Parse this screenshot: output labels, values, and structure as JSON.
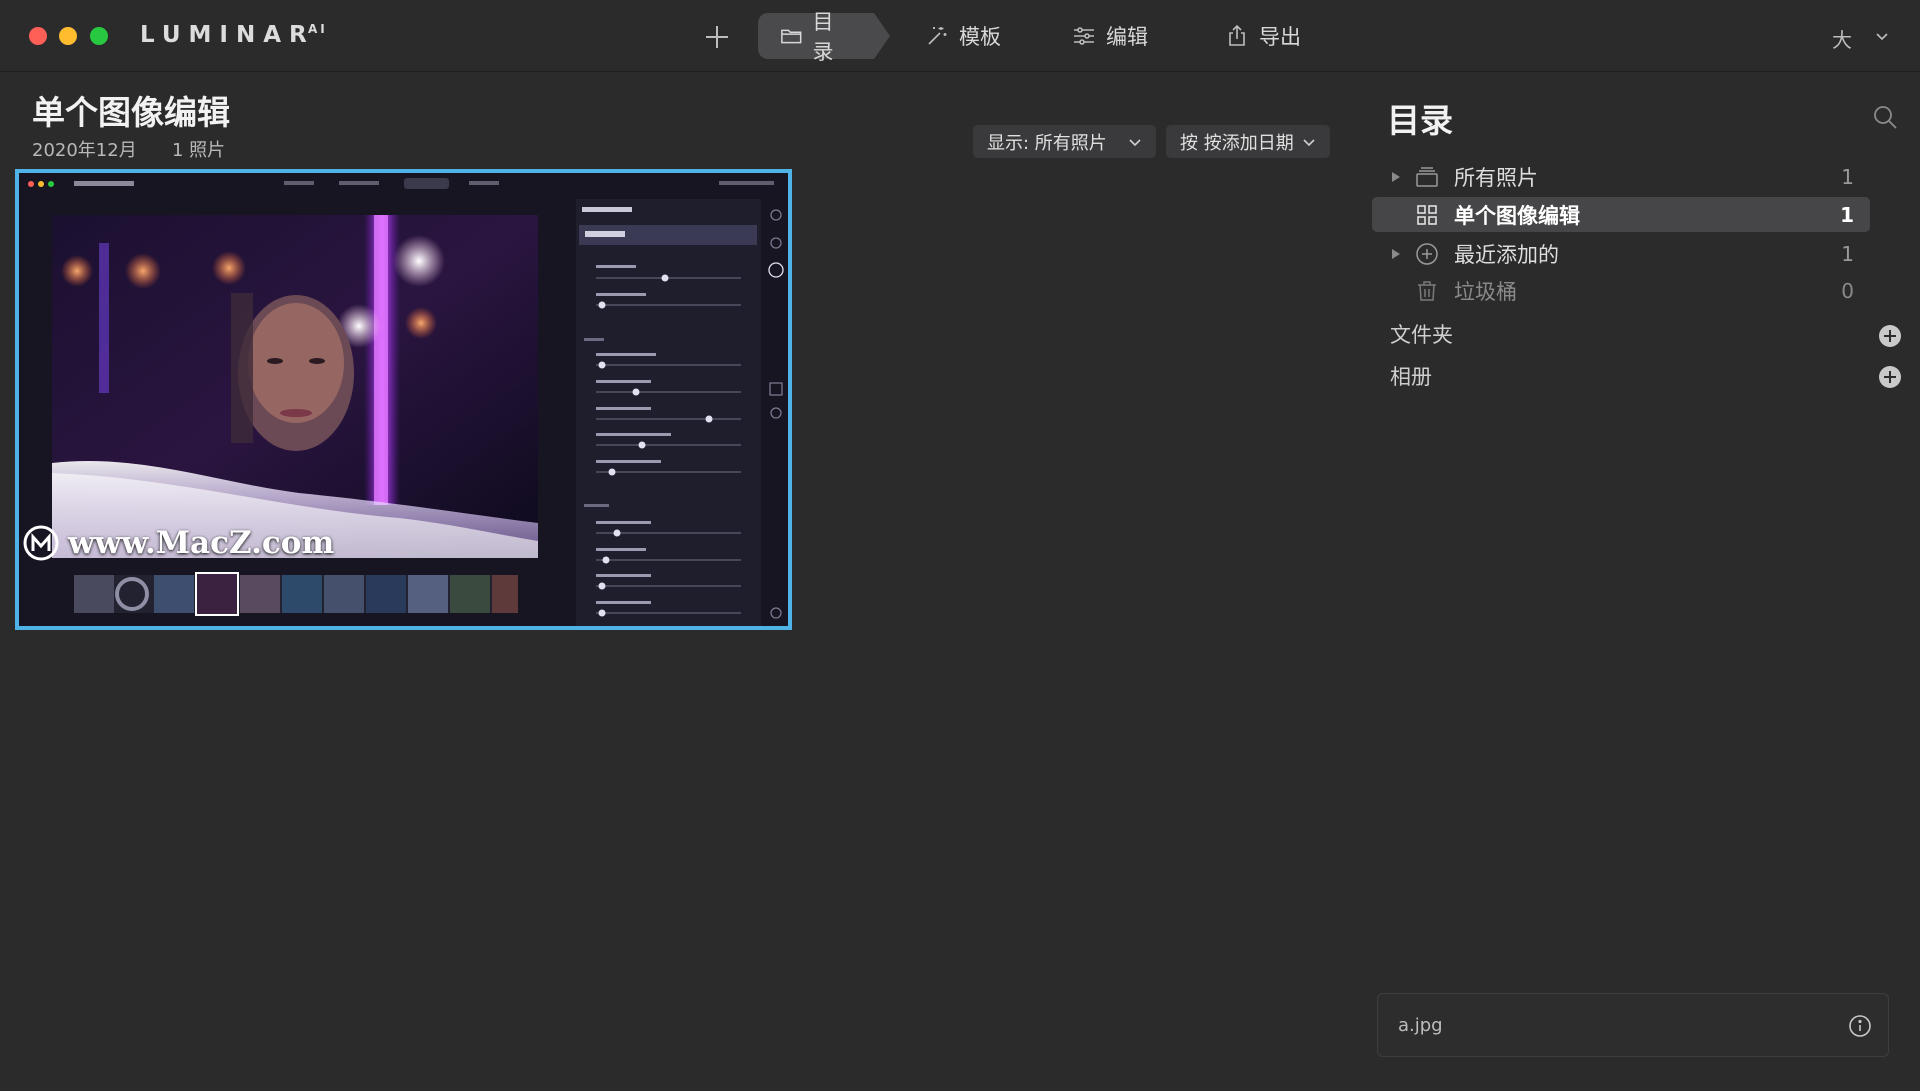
{
  "window": {
    "brand": "LUMINAR",
    "brand_sup": "AI",
    "size_label": "大"
  },
  "nav": {
    "catalog": "目录",
    "templates": "模板",
    "edit": "编辑",
    "export": "导出"
  },
  "main": {
    "title": "单个图像编辑",
    "date": "2020年12月",
    "count": "1 照片",
    "filter_show": "显示:  所有照片",
    "filter_sort": "按 按添加日期",
    "watermark": "www.MacZ.com"
  },
  "catalog_panel": {
    "title": "目录",
    "items": [
      {
        "label": "所有照片",
        "count": "1",
        "icon": "stack-icon"
      },
      {
        "label": "单个图像编辑",
        "count": "1",
        "icon": "grid-icon"
      },
      {
        "label": "最近添加的",
        "count": "1",
        "icon": "add-circle-icon"
      },
      {
        "label": "垃圾桶",
        "count": "0",
        "icon": "trash-icon"
      }
    ],
    "folders_label": "文件夹",
    "albums_label": "相册"
  },
  "file_info": {
    "name": "a.jpg"
  },
  "colors": {
    "background": "#2b2b2c",
    "selection_border": "#4fb3e8",
    "selected_row": "#464648"
  }
}
